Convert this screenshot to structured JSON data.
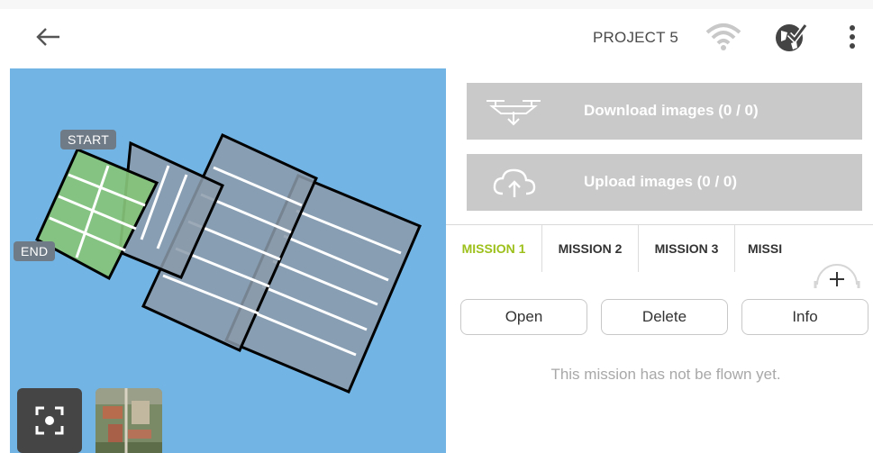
{
  "header": {
    "back_icon": "back-arrow-icon",
    "project_title": "PROJECT 5",
    "wifi_icon": "wifi-icon",
    "globe_icon": "globe-check-icon",
    "menu_icon": "more-vertical-icon"
  },
  "map": {
    "start_label": "START",
    "end_label": "END",
    "center_icon": "center-focus-icon",
    "background_color": "#72b4e4"
  },
  "actions": {
    "download_label": "Download images (0 / 0)",
    "download_icon": "drone-download-icon",
    "upload_label": "Upload images (0 / 0)",
    "upload_icon": "cloud-upload-icon"
  },
  "missions": {
    "tabs": [
      {
        "label": "MISSION 1",
        "active": true
      },
      {
        "label": "MISSION 2",
        "active": false
      },
      {
        "label": "MISSION 3",
        "active": false
      },
      {
        "label": "MISSI",
        "active": false
      }
    ],
    "add_icon": "plus-icon",
    "active_color": "#9dc01b",
    "buttons": {
      "open": "Open",
      "delete": "Delete",
      "info": "Info"
    },
    "status_text": "This mission has not be flown yet."
  }
}
